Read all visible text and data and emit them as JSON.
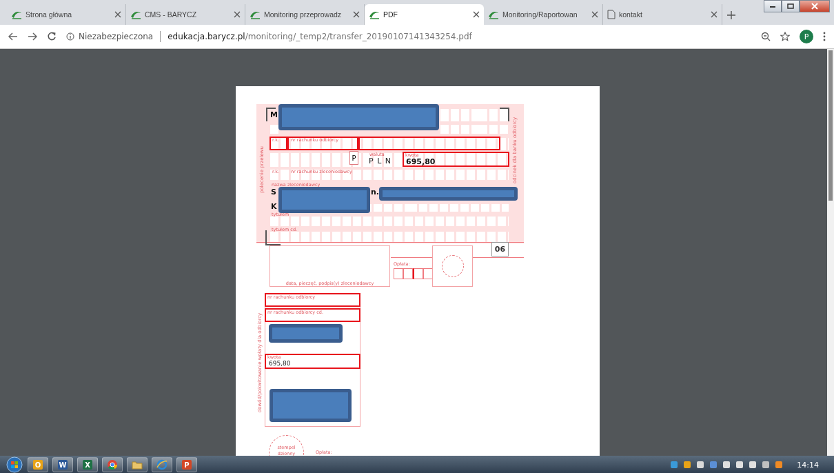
{
  "browser": {
    "tabs": [
      {
        "title": "Strona główna",
        "kind": "site",
        "selected": false
      },
      {
        "title": "CMS - BARYCZ",
        "kind": "site",
        "selected": false
      },
      {
        "title": "Monitoring przeprowadz",
        "kind": "site",
        "selected": false
      },
      {
        "title": "PDF",
        "kind": "site",
        "selected": true
      },
      {
        "title": "Monitoring/Raportowan",
        "kind": "site",
        "selected": false
      },
      {
        "title": "kontakt",
        "kind": "page",
        "selected": false
      }
    ],
    "security": "Niezabezpieczona",
    "url_host": "edukacja.barycz.pl",
    "url_path": "/monitoring/_temp2/transfer_20190107141343254.pdf",
    "profile": "P"
  },
  "transfer": {
    "side_title": "polecenie przelewu",
    "stub_title": "odcinek dla banku odbiorcy",
    "recipient_initial": "M",
    "rk_label": "r.k.",
    "recipient_account_label": "nr rachunku odbiorcy",
    "currency_box": "P",
    "currency_label": "waluta",
    "currency": "P L N",
    "amount_label": "kwota",
    "amount": "695,80",
    "sender_rk_label": "r.k.",
    "sender_account_label": "nr rachunku zleceniodawcy",
    "sender_name_label": "nazwa zleceniodawcy",
    "sender_name_start": "S",
    "sender_name_mid": "n.",
    "sender_address_start": "K",
    "title_label": "tytułem",
    "title2_label": "tytułem cd.",
    "form_code": "06",
    "fee_label": "Opłata:",
    "signature_caption": "data, pieczęć, podpis(y) zleceniodawcy"
  },
  "receipt": {
    "side_title": "dowód/pokwitowanie wpłaty dla odbiorcy",
    "account_label": "nr rachunku odbiorcy",
    "account2_label": "nr rachunku odbiorcy cd.",
    "amount_label": "kwota",
    "amount": "695,80",
    "stamp_label": "stempel dzienny",
    "fee_label": "Opłata:"
  },
  "taskbar": {
    "apps": [
      {
        "kind": "outlook",
        "glyph": "O"
      },
      {
        "kind": "word",
        "glyph": "W"
      },
      {
        "kind": "excel",
        "glyph": "X"
      },
      {
        "kind": "chrome"
      },
      {
        "kind": "folder"
      },
      {
        "kind": "ie"
      },
      {
        "kind": "powerpoint",
        "glyph": "P"
      }
    ],
    "clock": "14:14"
  }
}
